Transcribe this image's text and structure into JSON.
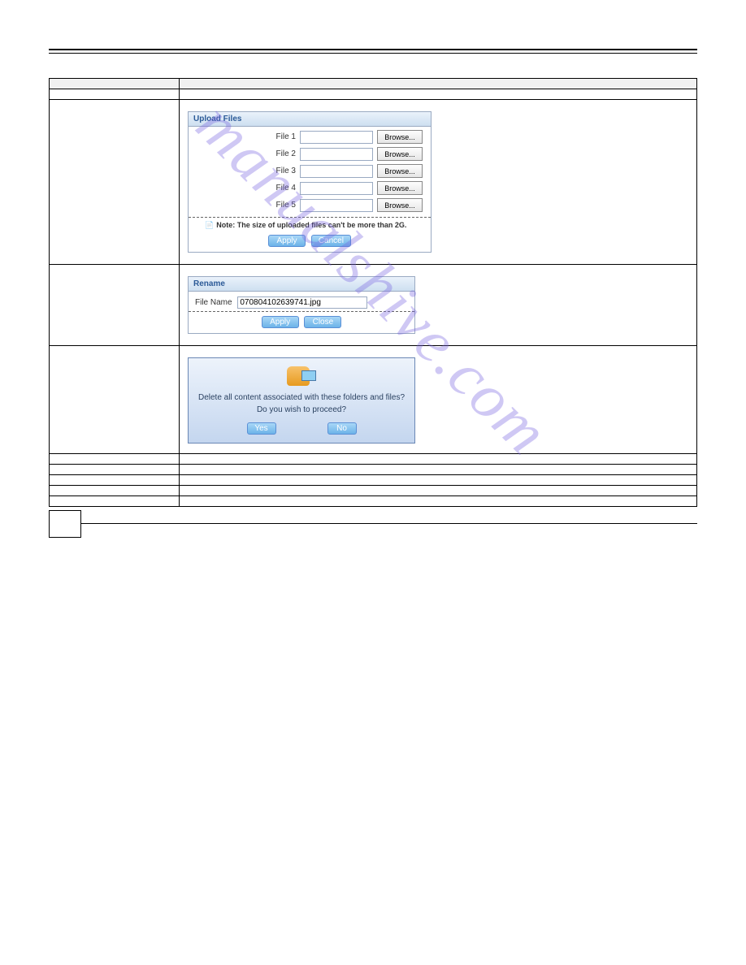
{
  "watermark": "manualshive.com",
  "page_header": {
    "chapter": " ",
    "product": " "
  },
  "section_title": " ",
  "intro_text": " ",
  "table": {
    "headers": [
      " ",
      " "
    ],
    "rows": [
      {
        "label": " ",
        "desc": " "
      },
      {
        "label": " ",
        "desc_before": " ",
        "desc_after": " "
      },
      {
        "label": " ",
        "desc_before": " ",
        "desc_after": " "
      },
      {
        "label": " ",
        "desc": " "
      },
      {
        "label": " ",
        "desc": " "
      },
      {
        "label": " ",
        "desc": " "
      },
      {
        "label": " ",
        "desc": " "
      },
      {
        "label": " ",
        "desc": " "
      },
      {
        "label": " ",
        "desc": " "
      }
    ]
  },
  "upload_panel": {
    "title": "Upload Files",
    "file_label_prefix": "File",
    "rows": [
      1,
      2,
      3,
      4,
      5
    ],
    "browse": "Browse...",
    "note": "Note: The size of uploaded files can't be more than 2G.",
    "apply": "Apply",
    "cancel": "Cancel"
  },
  "rename_panel": {
    "title": "Rename",
    "field_label": "File Name",
    "value": "070804102639741.jpg",
    "apply": "Apply",
    "close": "Close"
  },
  "confirm_dialog": {
    "line1": "Delete all content associated with these folders and files?",
    "line2": "Do you wish to proceed?",
    "yes": "Yes",
    "no": "No"
  },
  "page_number": " "
}
